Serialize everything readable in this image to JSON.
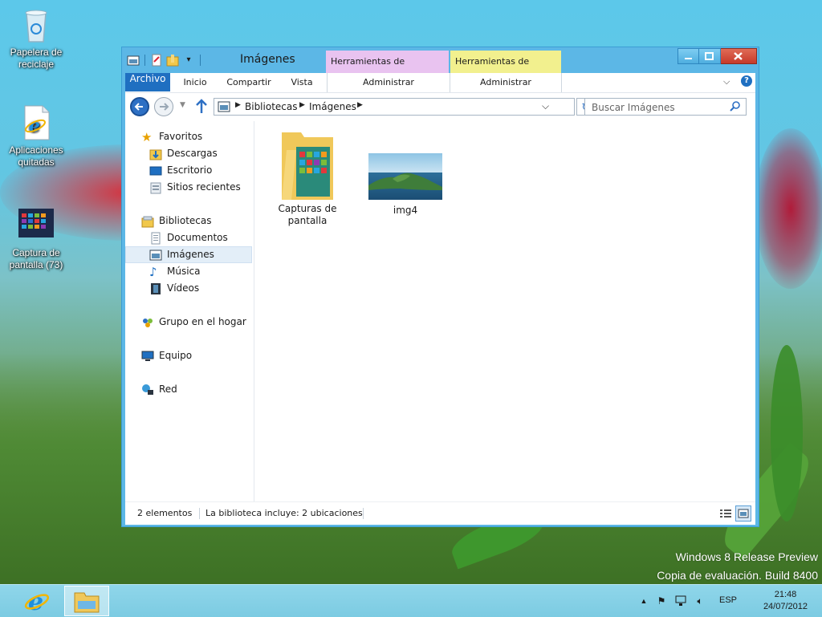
{
  "desktop": {
    "icons": [
      {
        "label": "Papelera de reciclaje",
        "icon": "recycle-bin-icon"
      },
      {
        "label": "Aplicaciones quitadas",
        "icon": "internet-explorer-file-icon"
      },
      {
        "label": "Captura de pantalla (73)",
        "icon": "screenshot-image-icon"
      }
    ],
    "watermark_line1": "Windows 8 Release Preview",
    "watermark_line2": "Copia de evaluación. Build 8400"
  },
  "window": {
    "title": "Imágenes",
    "context_tabs": {
      "library_tools": "Herramientas de biblioteca",
      "image_tools": "Herramientas de imagen"
    },
    "ribbon_tabs": [
      "Archivo",
      "Inicio",
      "Compartir",
      "Vista",
      "Administrar",
      "Administrar"
    ],
    "address": {
      "crumbs": [
        "Bibliotecas",
        "Imágenes"
      ]
    },
    "search": {
      "placeholder": "Buscar Imágenes"
    },
    "nav_pane": {
      "favorites": {
        "header": "Favoritos",
        "items": [
          "Descargas",
          "Escritorio",
          "Sitios recientes"
        ]
      },
      "libraries": {
        "header": "Bibliotecas",
        "items": [
          "Documentos",
          "Imágenes",
          "Música",
          "Vídeos"
        ],
        "selected": "Imágenes"
      },
      "homegroup": "Grupo en el hogar",
      "computer": "Equipo",
      "network": "Red"
    },
    "files": [
      {
        "name_line1": "Capturas de",
        "name_line2": "pantalla",
        "type": "folder"
      },
      {
        "name_line1": "img4",
        "name_line2": "",
        "type": "image"
      }
    ],
    "status": {
      "count": "2 elementos",
      "info": "La biblioteca incluye: 2 ubicaciones"
    }
  },
  "taskbar": {
    "apps": [
      "internet-explorer-icon",
      "file-explorer-icon"
    ],
    "language": "ESP",
    "time": "21:48",
    "date": "24/07/2012"
  },
  "colors": {
    "titlebar": "#5cb7e6",
    "file_tab": "#1f6fc1",
    "library_tools_tab": "#e9c3f0",
    "image_tools_tab": "#f2f08e",
    "close_button": "#c6392a",
    "taskbar": "#7ccbe2"
  }
}
